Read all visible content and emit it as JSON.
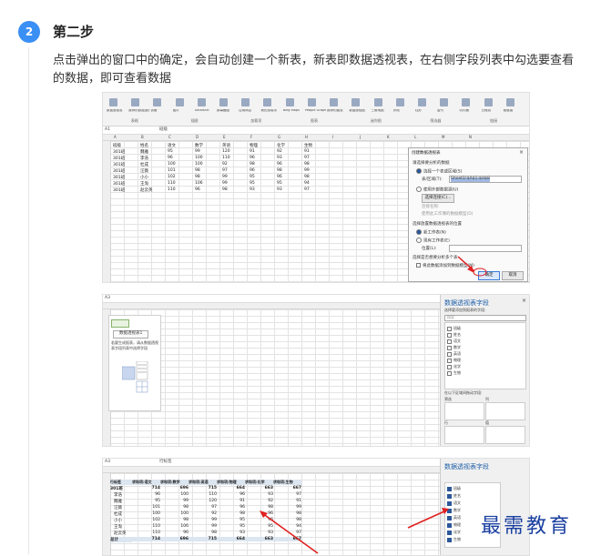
{
  "step": {
    "number": "2",
    "title": "第二步"
  },
  "description": "点击弹出的窗口中的确定，会自动创建一个新表，新表即数据透视表，在右侧字段列表中勾选要查看的数据，即可查看数据",
  "watermark": "最需教育",
  "colors": {
    "accent": "#3a8ff5",
    "excel_blue": "#2b579a",
    "arrow_red": "#e02020",
    "watermark": "#1a3fa0"
  },
  "shot1": {
    "ribbon_groups": [
      "表格",
      "插图",
      "加载项",
      "图表",
      "迷你图",
      "筛选器",
      "链接"
    ],
    "ribbon_items": [
      "数据透视表",
      "推荐的数据透视表",
      "表格",
      "图片",
      "SmartArt",
      "屏幕截图",
      "应用商店",
      "我的加载项",
      "Bing Maps",
      "People Graph",
      "推荐的图表",
      "数据透视图",
      "三维地图",
      "折线",
      "柱形",
      "盈亏",
      "切片器",
      "日程表",
      "超链接"
    ],
    "name_box": "A1",
    "formula": "班级",
    "columns": [
      "A",
      "B",
      "C",
      "D",
      "E",
      "F",
      "G",
      "H",
      "I",
      "J",
      "K",
      "L",
      "M",
      "N"
    ],
    "headers": [
      "班级",
      "姓名",
      "语文",
      "数学",
      "英语",
      "物理",
      "化学",
      "生物"
    ],
    "rows": [
      [
        "301班",
        "魏雅",
        "95",
        "99",
        "120",
        "91",
        "92",
        "91"
      ],
      [
        "301班",
        "李浩",
        "96",
        "100",
        "110",
        "96",
        "93",
        "97"
      ],
      [
        "301班",
        "杜成",
        "100",
        "100",
        "92",
        "98",
        "96",
        "98"
      ],
      [
        "301班",
        "汪薇",
        "101",
        "98",
        "97",
        "96",
        "98",
        "99"
      ],
      [
        "301班",
        "小小",
        "102",
        "98",
        "99",
        "95",
        "96",
        "98"
      ],
      [
        "301班",
        "王淘",
        "110",
        "106",
        "99",
        "95",
        "95",
        "94"
      ],
      [
        "301班",
        "赵云英",
        "110",
        "96",
        "98",
        "93",
        "93",
        "97"
      ]
    ],
    "dialog": {
      "title": "创建数据透视表",
      "section1": "请选择要分析的数据",
      "opt_table": "选择一个表或区域(S)",
      "range_label": "表/区域(T):",
      "range_value": "Sheet1!$A$1:$H$8",
      "opt_external": "使用外部数据源(U)",
      "choose_conn": "选择连接(C)...",
      "conn_name": "连接名称:",
      "use_model": "使用此工作簿的数据模型(D)",
      "section2": "选择放置数据透视表的位置",
      "opt_new": "新工作表(N)",
      "opt_existing": "现有工作表(E)",
      "location": "位置(L):",
      "section3": "选择是否想要分析多个表",
      "add_model": "将此数据添加到数据模型(M)",
      "ok": "确定",
      "cancel": "取消"
    }
  },
  "shot2": {
    "name_box": "A3",
    "placeholder_title": "数据透视表1",
    "placeholder_text": "若要生成报表，请从数据透视表字段列表中选择字段",
    "pane": {
      "title": "数据透视表字段",
      "subtitle": "选择要添加到报表的字段:",
      "search": "搜索",
      "fields": [
        "班级",
        "姓名",
        "语文",
        "数学",
        "英语",
        "物理",
        "化学",
        "生物"
      ],
      "drag_hint": "在以下区域间拖动字段:",
      "areas": [
        "筛选",
        "列",
        "行",
        "值"
      ]
    }
  },
  "shot3": {
    "name_box": "A3",
    "formula": "行标签",
    "header_row": [
      "行标签",
      "求和项:语文",
      "求和项:数学",
      "求和项:英语",
      "求和项:物理",
      "求和项:化学",
      "求和项:生物"
    ],
    "rows": [
      [
        "301班",
        "714",
        "696",
        "715",
        "664",
        "663",
        "667"
      ],
      [
        "李浩",
        "96",
        "100",
        "110",
        "96",
        "93",
        "97"
      ],
      [
        "魏雅",
        "95",
        "99",
        "120",
        "91",
        "92",
        "91"
      ],
      [
        "汪薇",
        "101",
        "98",
        "97",
        "96",
        "98",
        "99"
      ],
      [
        "杜成",
        "100",
        "100",
        "92",
        "98",
        "96",
        "98"
      ],
      [
        "小小",
        "102",
        "98",
        "99",
        "95",
        "96",
        "98"
      ],
      [
        "王淘",
        "110",
        "106",
        "99",
        "95",
        "95",
        "94"
      ],
      [
        "赵云英",
        "110",
        "96",
        "98",
        "93",
        "93",
        "97"
      ],
      [
        "总计",
        "714",
        "696",
        "715",
        "664",
        "663",
        "667"
      ]
    ],
    "pane": {
      "title": "数据透视表字段",
      "fields": [
        "班级",
        "姓名",
        "语文",
        "数学",
        "英语",
        "物理",
        "化学",
        "生物"
      ]
    }
  }
}
